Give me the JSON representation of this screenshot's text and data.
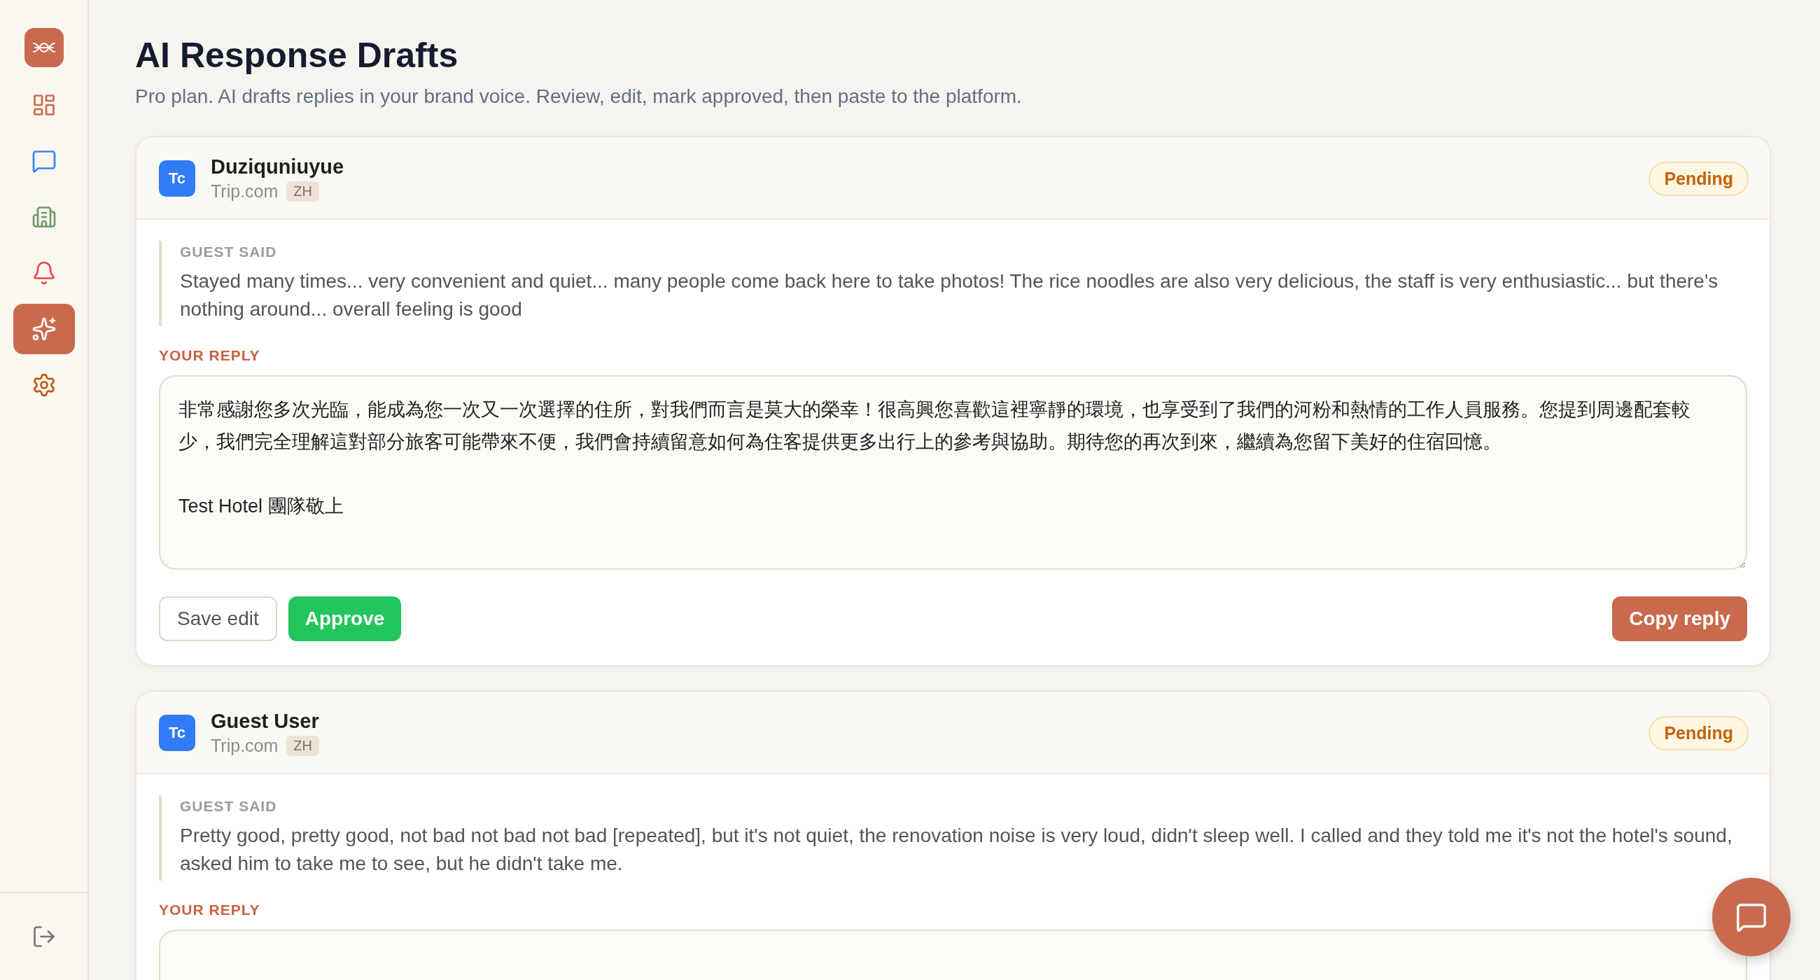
{
  "sidebar": {
    "items": [
      {
        "kind": "dashboard",
        "selected": false
      },
      {
        "kind": "messages",
        "selected": false
      },
      {
        "kind": "building",
        "selected": false
      },
      {
        "kind": "alerts",
        "selected": false
      },
      {
        "kind": "ai",
        "selected": true
      },
      {
        "kind": "settings",
        "selected": false
      }
    ],
    "footer": {
      "kind": "logout"
    }
  },
  "page": {
    "title": "AI Response Drafts",
    "subtitle": "Pro plan. AI drafts replies in your brand voice. Review, edit, mark approved, then paste to the platform."
  },
  "drafts": [
    {
      "avatar": "Tc",
      "name": "Duziquniuyue",
      "platform": "Trip.com",
      "language": "ZH",
      "status": {
        "label": "Pending",
        "kind": "pending"
      },
      "guest_label": "GUEST SAID",
      "review": "Stayed many times... very convenient and quiet... many people come back here to take photos! The rice noodles are also very delicious, the staff is very enthusiastic... but there's nothing around... overall feeling is good",
      "reply_label": "YOUR REPLY",
      "reply": "非常感謝您多次光臨，能成為您一次又一次選擇的住所，對我們而言是莫大的榮幸！很高興您喜歡這裡寧靜的環境，也享受到了我們的河粉和熱情的工作人員服務。您提到周邊配套較少，我們完全理解這對部分旅客可能帶來不便，我們會持續留意如何為住客提供更多出行上的參考與協助。期待您的再次到來，繼續為您留下美好的住宿回憶。\n\nTest Hotel 團隊敬上",
      "actions": [
        {
          "label": "Save edit",
          "kind": "outline"
        },
        {
          "label": "Approve",
          "kind": "approve"
        },
        {
          "label": "Copy reply",
          "kind": "copy"
        }
      ]
    },
    {
      "avatar": "Tc",
      "name": "Guest User",
      "platform": "Trip.com",
      "language": "ZH",
      "status": {
        "label": "Pending",
        "kind": "pending"
      },
      "guest_label": "GUEST SAID",
      "review": "Pretty good, pretty good, not bad not bad not bad [repeated], but it's not quiet, the renovation noise is very loud, didn't sleep well. I called and they told me it's not the hotel's sound, asked him to take me to see, but he didn't take me.",
      "reply_label": "YOUR REPLY"
    }
  ],
  "chat_button": {
    "kind": "chat"
  }
}
